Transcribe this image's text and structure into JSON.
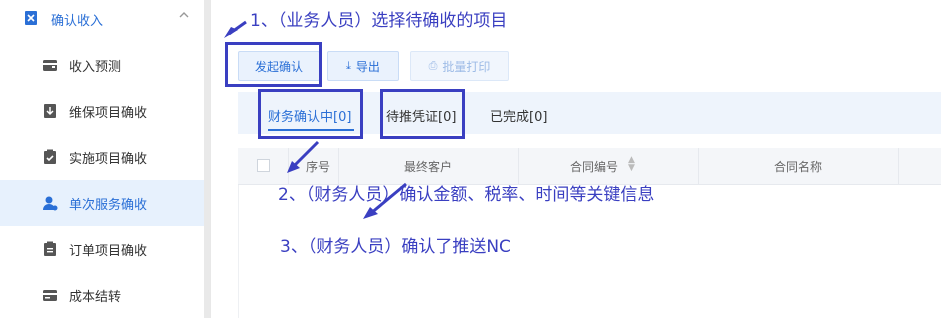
{
  "sidebar": {
    "group_label": "确认收入",
    "items": [
      {
        "label": "收入预测",
        "icon": "wallet-icon"
      },
      {
        "label": "维保项目确收",
        "icon": "download-doc-icon"
      },
      {
        "label": "实施项目确收",
        "icon": "clipboard-check-icon"
      },
      {
        "label": "单次服务确收",
        "icon": "user-icon",
        "active": true
      },
      {
        "label": "订单项目确收",
        "icon": "clipboard-icon"
      },
      {
        "label": "成本结转",
        "icon": "card-icon"
      }
    ]
  },
  "toolbar": {
    "initiate_label": "发起确认",
    "export_label": "导出",
    "print_label": "批量打印"
  },
  "tabs": [
    {
      "label": "财务确认中[0]",
      "active": true
    },
    {
      "label": "待推凭证[0]"
    },
    {
      "label": "已完成[0]"
    }
  ],
  "table": {
    "columns": [
      "序号",
      "最终客户",
      "合同编号",
      "合同名称"
    ]
  },
  "annotations": {
    "step1": "1、（业务人员）选择待确收的项目",
    "step2": "2、（财务人员）确认金额、税率、时间等关键信息",
    "step3": "3、（财务人员）确认了推送NC"
  },
  "colors": {
    "accent": "#2a6fd6",
    "annotation": "#3a3fc1",
    "active_bg": "#e7f1fd"
  }
}
